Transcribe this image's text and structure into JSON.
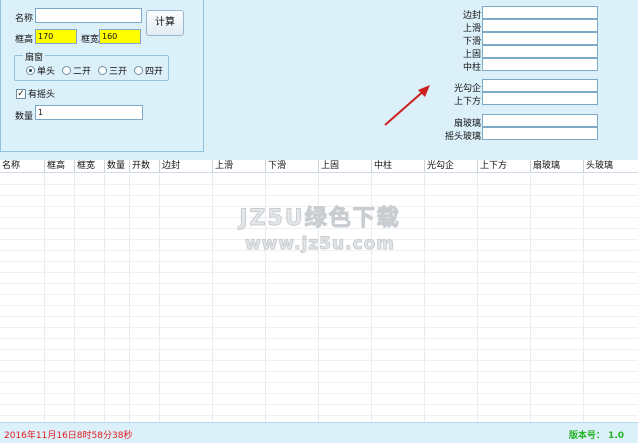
{
  "form": {
    "name_label": "名称",
    "name_value": "",
    "frame_height_label": "框高",
    "frame_height_value": "170",
    "frame_width_label": "框宽",
    "frame_width_value": "160",
    "calc_button": "计算",
    "sash_group_title": "扇窗",
    "radio_options": [
      "单头",
      "二开",
      "三开",
      "四开"
    ],
    "radio_selected": "单头",
    "has_top_label": "有摇头",
    "has_top_checked": true,
    "quantity_label": "数量",
    "quantity_value": "1"
  },
  "results": {
    "labels": [
      "边封",
      "上滑",
      "下滑",
      "上固",
      "中柱",
      "光勾企",
      "上下方",
      "扇玻璃",
      "摇头玻璃"
    ]
  },
  "table": {
    "columns": [
      "名称",
      "框高",
      "框宽",
      "数量",
      "开数",
      "边封",
      "上滑",
      "下滑",
      "上固",
      "中柱",
      "光勾企",
      "上下方",
      "扇玻璃",
      "头玻璃"
    ]
  },
  "watermark": {
    "line1": "JZ5U绿色下载",
    "line2": "www.jz5u.com"
  },
  "status": {
    "datetime": "2016年11月16日8时58分38秒",
    "version": "版本号： 1.0"
  },
  "colors": {
    "highlight_input": "#ffff00",
    "status_time": "#e01c1c",
    "status_version": "#22b222",
    "panel_bg": "#dcf0fa",
    "arrow": "#cc1f1f"
  }
}
